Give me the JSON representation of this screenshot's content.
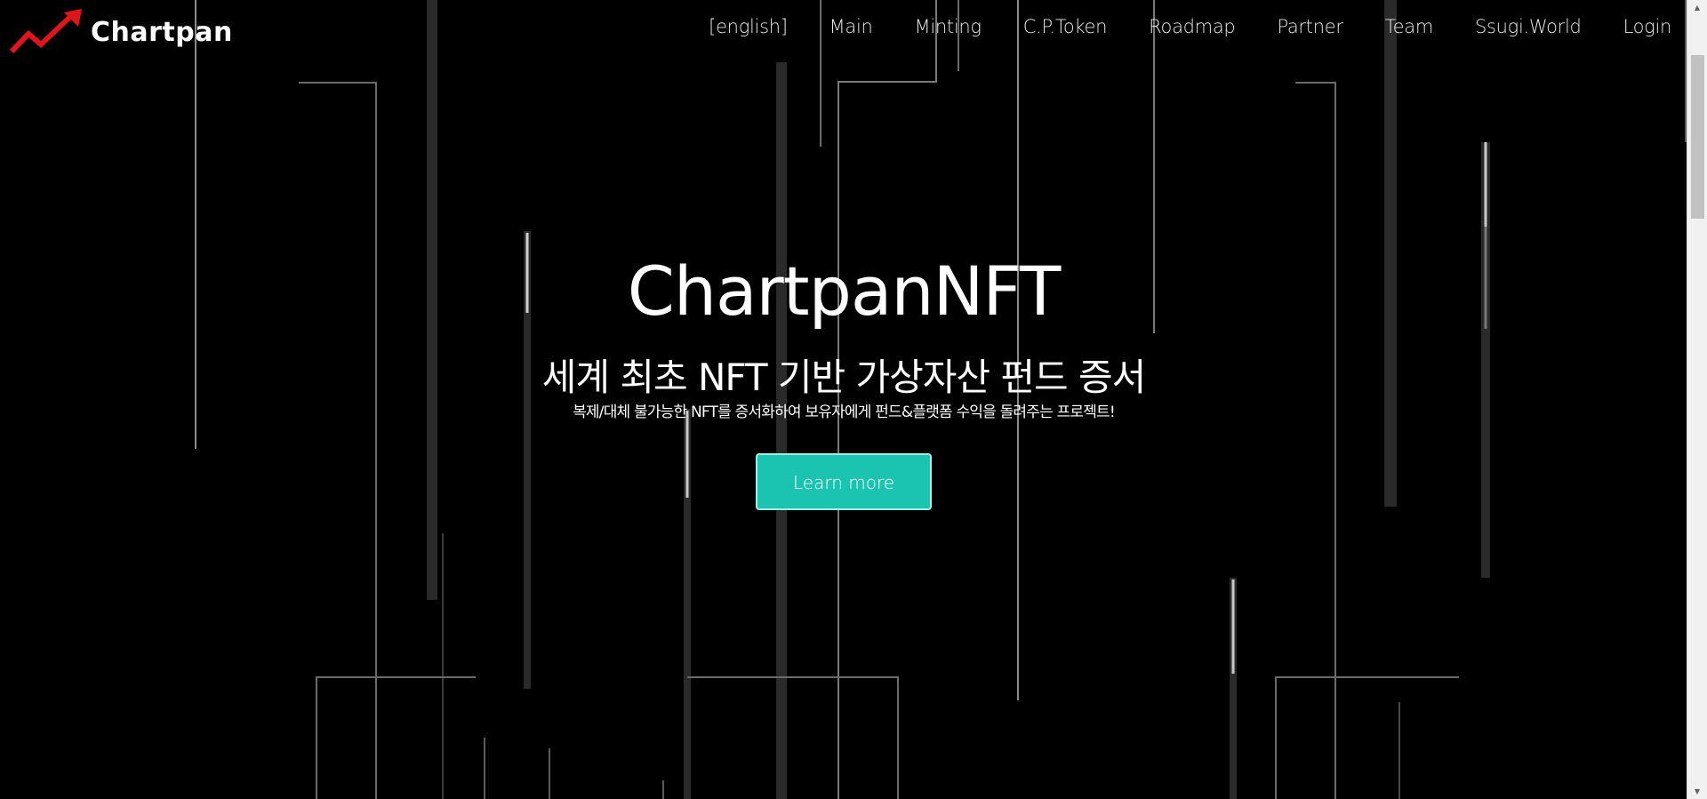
{
  "brand": {
    "name": "Chartpan",
    "accent_color": "#e0151c"
  },
  "nav": {
    "items": [
      {
        "label": "[english]"
      },
      {
        "label": "Main"
      },
      {
        "label": "Minting"
      },
      {
        "label": "C.P.Token"
      },
      {
        "label": "Roadmap"
      },
      {
        "label": "Partner"
      },
      {
        "label": "Team"
      },
      {
        "label": "Ssugi.World"
      },
      {
        "label": "Login"
      }
    ]
  },
  "hero": {
    "title": "ChartpanNFT",
    "subtitle": "세계 최초 NFT 기반 가상자산 펀드 증서",
    "description": "복제/대체 불가능한 NFT를 증서화하여 보유자에게 펀드&플랫폼 수익을 돌려주는 프로젝트!",
    "cta_label": "Learn more",
    "cta_color": "#1bc4b1"
  },
  "scrollbar": {
    "up_icon": "triangle-up-icon",
    "down_icon": "triangle-down-icon"
  }
}
